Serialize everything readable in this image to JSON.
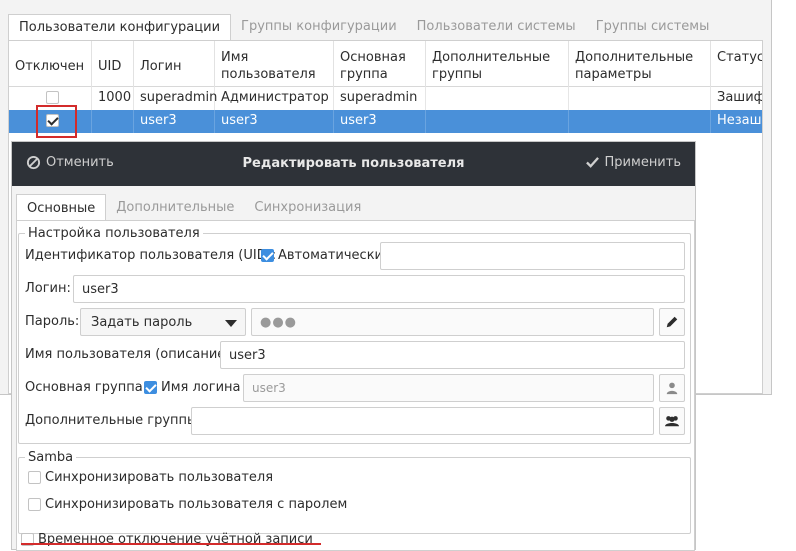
{
  "tabs": [
    "Пользователи конфигурации",
    "Группы конфигурации",
    "Пользователи системы",
    "Группы системы"
  ],
  "columns": {
    "disabled": "Отключен",
    "uid": "UID",
    "login": "Логин",
    "username": "Имя пользователя",
    "main_group": "Основная группа",
    "extra_groups": "Дополнительные группы",
    "extra_params": "Дополнительные параметры",
    "status": "Статус пароля"
  },
  "rows": [
    {
      "disabled": false,
      "uid": "1000",
      "login": "superadmin",
      "username": "Администратор",
      "main_group": "superadmin",
      "extra_groups": "",
      "extra_params": "",
      "status": "Зашифрован"
    },
    {
      "disabled": true,
      "uid": "",
      "login": "user3",
      "username": "user3",
      "main_group": "user3",
      "extra_groups": "",
      "extra_params": "",
      "status": "Незашифрован"
    }
  ],
  "dialog": {
    "title": "Редактировать пользователя",
    "cancel": "Отменить",
    "apply": "Применить",
    "tabs": [
      "Основные",
      "Дополнительные",
      "Синхронизация"
    ],
    "user_settings": {
      "legend": "Настройка пользователя",
      "uid_label": "Идентификатор пользователя (UID):",
      "uid_auto": "Автоматически",
      "uid_value": "",
      "login_label": "Логин:",
      "login_value": "user3",
      "password_label": "Пароль:",
      "password_mode": "Задать пароль",
      "password_value": "●●●",
      "description_label": "Имя пользователя (описание):",
      "description_value": "user3",
      "main_group_label": "Основная группа:",
      "main_group_checkbox": "Имя логина",
      "main_group_value": "user3",
      "extra_groups_label": "Дополнительные группы:",
      "extra_groups_value": ""
    },
    "samba": {
      "legend": "Samba",
      "sync_user": "Синхронизировать пользователя",
      "sync_user_password": "Синхронизировать пользователя с паролем"
    },
    "temp_disable": "Временное отключение учётной записи"
  },
  "colors": {
    "accent": "#4a90d9",
    "headerbar": "#2e3238",
    "highlight": "#d32b2b"
  }
}
